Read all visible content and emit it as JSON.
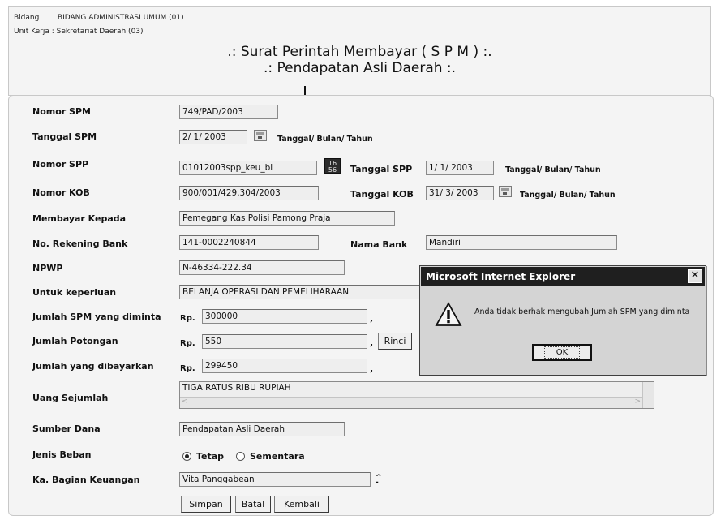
{
  "header": {
    "bidang_label": "Bidang",
    "bidang_value": ": BIDANG ADMINISTRASI UMUM (01)",
    "unit_kerja": "Unit Kerja : Sekretariat Daerah (03)",
    "title_line1": ".: Surat Perintah Membayar ( S P M ) :.",
    "title_line2": ".: Pendapatan Asli Daerah :."
  },
  "form": {
    "nomor_spm": {
      "label": "Nomor SPM",
      "value": "749/PAD/2003"
    },
    "tanggal_spm": {
      "label": "Tanggal SPM",
      "value": "2/ 1/ 2003",
      "hint": "Tanggal/ Bulan/ Tahun"
    },
    "nomor_spp": {
      "label": "Nomor SPP",
      "value": "01012003spp_keu_bl"
    },
    "tanggal_spp": {
      "label": "Tanggal SPP",
      "value": "1/ 1/ 2003",
      "hint": "Tanggal/ Bulan/ Tahun"
    },
    "nomor_kob": {
      "label": "Nomor KOB",
      "value": "900/001/429.304/2003"
    },
    "tanggal_kob": {
      "label": "Tanggal KOB",
      "value": "31/ 3/ 2003",
      "hint": "Tanggal/ Bulan/ Tahun"
    },
    "membayar_kepada": {
      "label": "Membayar Kepada",
      "value": "Pemegang Kas Polisi Pamong Praja"
    },
    "no_rekening": {
      "label": "No. Rekening Bank",
      "value": "141-0002240844"
    },
    "nama_bank": {
      "label": "Nama Bank",
      "value": "Mandiri"
    },
    "npwp": {
      "label": "NPWP",
      "value": "N-46334-222.34"
    },
    "untuk_keperluan": {
      "label": "Untuk keperluan",
      "value": "BELANJA OPERASI DAN PEMELIHARAAN"
    },
    "jumlah_spm": {
      "label": "Jumlah SPM yang diminta",
      "currency": "Rp.",
      "value": "300000"
    },
    "jumlah_potongan": {
      "label": "Jumlah Potongan",
      "currency": "Rp.",
      "value": "550",
      "rinci_label": "Rinci"
    },
    "jumlah_dibayarkan": {
      "label": "Jumlah yang dibayarkan",
      "currency": "Rp.",
      "value": "299450"
    },
    "uang_sejumlah": {
      "label": "Uang Sejumlah",
      "value": "TIGA RATUS RIBU RUPIAH"
    },
    "sumber_dana": {
      "label": "Sumber Dana",
      "value": "Pendapatan Asli Daerah"
    },
    "jenis_beban": {
      "label": "Jenis Beban",
      "option1": "Tetap",
      "option2": "Sementara",
      "selected": "Tetap"
    },
    "ka_bagian": {
      "label": "Ka. Bagian Keuangan",
      "value": "Vita Panggabean"
    },
    "comma": ","
  },
  "buttons": {
    "simpan": "Simpan",
    "batal": "Batal",
    "kembali": "Kembali"
  },
  "dialog": {
    "title": "Microsoft Internet Explorer",
    "message": "Anda tidak berhak mengubah Jumlah SPM yang diminta",
    "ok_label": "OK",
    "close_glyph": "✕",
    "icon": "warning-icon"
  },
  "icons": {
    "lookup_text": "16\n56"
  }
}
